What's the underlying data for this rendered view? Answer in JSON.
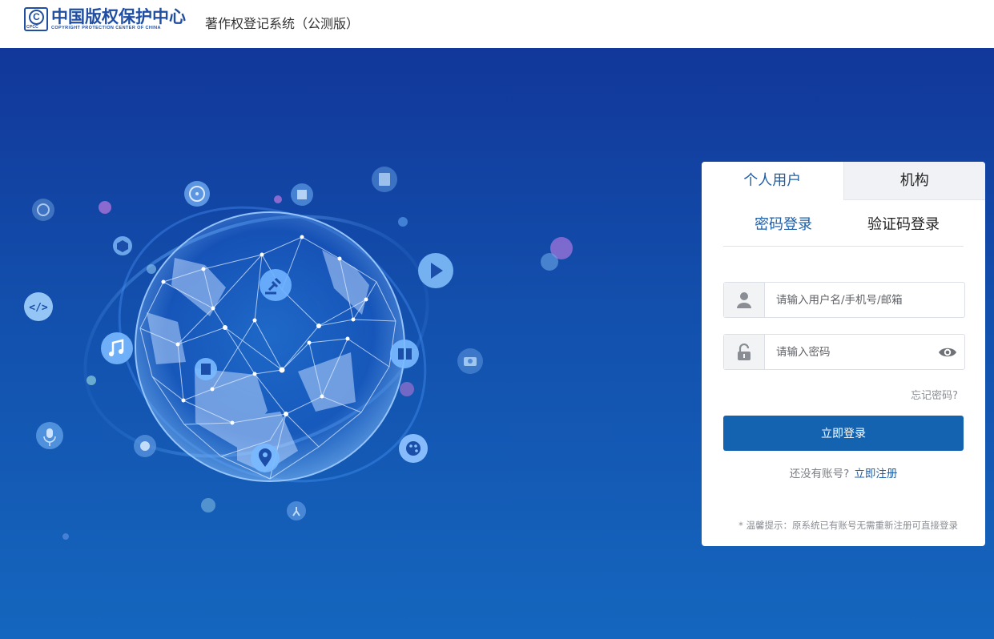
{
  "header": {
    "logo_mark_letter": "C",
    "logo_mark_small": "CPCC",
    "logo_cn": "中国版权保护中心",
    "logo_en": "COPYRIGHT PROTECTION CENTER OF CHINA",
    "system_title": "著作权登记系统（公测版）"
  },
  "login": {
    "tabs": [
      "个人用户",
      "机构"
    ],
    "subtabs": [
      "密码登录",
      "验证码登录"
    ],
    "username_placeholder": "请输入用户名/手机号/邮箱",
    "password_placeholder": "请输入密码",
    "forgot": "忘记密码?",
    "submit": "立即登录",
    "no_account": "还没有账号?",
    "register_link": "立即注册",
    "tip": "* 温馨提示：原系统已有账号无需重新注册可直接登录"
  },
  "colors": {
    "brand": "#1f4ea3",
    "primary_button": "#1463b1",
    "hero_top": "#11379a",
    "hero_bottom": "#1466be"
  },
  "icons": [
    "user-icon",
    "lock-icon",
    "eye-icon",
    "gavel-icon",
    "music-icon",
    "book-icon",
    "location-icon",
    "play-icon",
    "code-icon",
    "microphone-icon",
    "palette-icon",
    "camera-icon",
    "film-reel-icon",
    "building-icon",
    "image-icon",
    "cube-icon",
    "compass-icon",
    "mask-icon",
    "dancer-icon",
    "notebook-icon"
  ]
}
